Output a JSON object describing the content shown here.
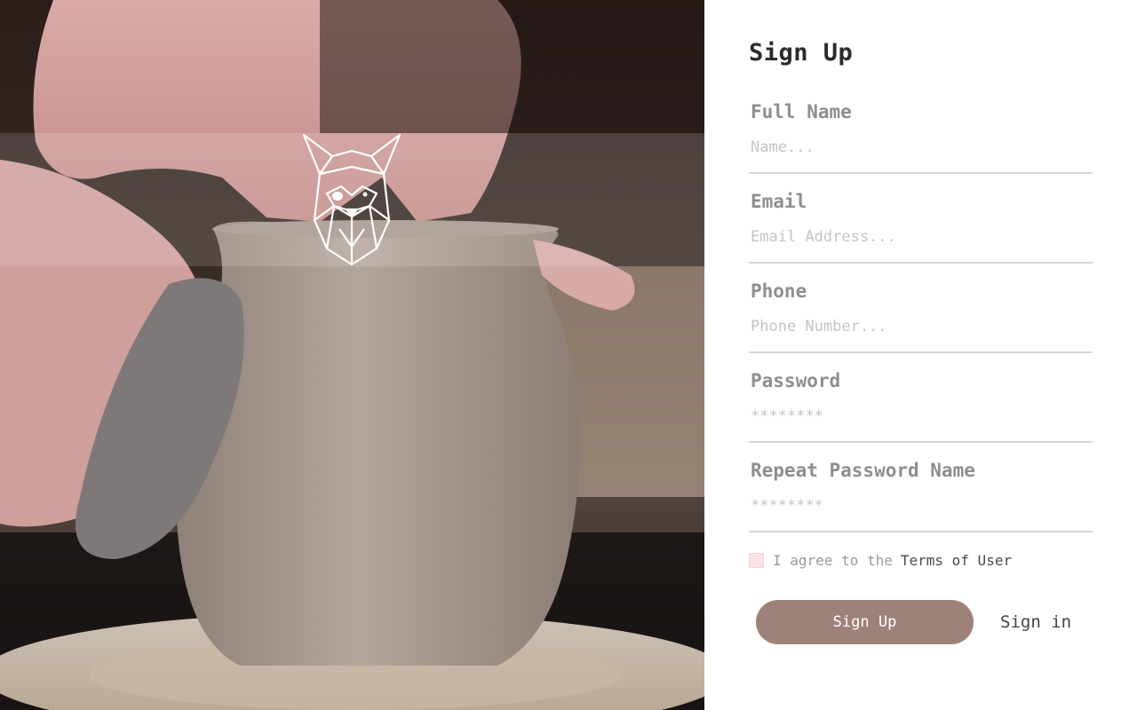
{
  "hero": {
    "image": "pottery-wheel-hands-shaping-clay-vase",
    "logo_icon": "geometric-dog-head-logo-icon"
  },
  "form": {
    "title": "Sign Up",
    "fields": [
      {
        "label": "Full Name",
        "placeholder": "Name...",
        "value": ""
      },
      {
        "label": "Email",
        "placeholder": "Email Address...",
        "value": ""
      },
      {
        "label": "Phone",
        "placeholder": "Phone Number...",
        "value": ""
      },
      {
        "label": "Password",
        "placeholder": "********",
        "value": ""
      },
      {
        "label": "Repeat Password Name",
        "placeholder": "********",
        "value": ""
      }
    ],
    "terms_text": "I agree to the",
    "terms_link": "Terms of User",
    "terms_checked": false,
    "signup_button": "Sign Up",
    "signin_link": "Sign in"
  },
  "colors": {
    "accent": "#9e8279",
    "checkbox": "#fde4e4",
    "label": "#8e8e8e",
    "divider": "#d6d6d6"
  }
}
